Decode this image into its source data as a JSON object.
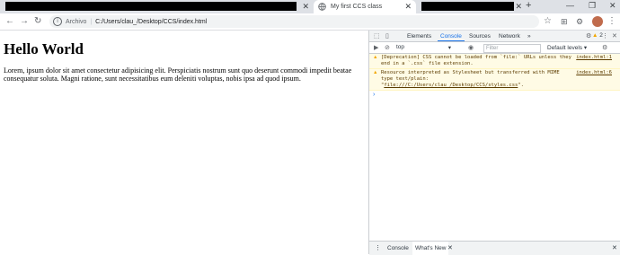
{
  "browser": {
    "tabs": [
      {
        "label": "",
        "redacted": true
      },
      {
        "label": "My first CCS class",
        "active": true
      },
      {
        "label": "",
        "redacted": true
      }
    ],
    "close_glyph": "✕",
    "new_tab_glyph": "+",
    "window_controls": [
      "—",
      "❐",
      "✕"
    ],
    "nav": {
      "back": "←",
      "forward": "→",
      "reload": "↻"
    },
    "address": {
      "info_glyph": "i",
      "scheme_label": "Archivo",
      "separator": "|",
      "url": "C:/Users/clau_/Desktop/CCS/index.html"
    },
    "toolbar_icons": {
      "star": "☆",
      "extension1": "⊞",
      "extension2": "⚙",
      "menu": "⋮"
    }
  },
  "page": {
    "heading": "Hello World",
    "paragraph": "Lorem, ipsum dolor sit amet consectetur adipisicing elit. Perspiciatis nostrum sunt quo deserunt commodi impedit beatae consequatur soluta. Magni ratione, sunt necessitatibus eum deleniti voluptas, nobis ipsa ad quod ipsum."
  },
  "devtools": {
    "tabs": [
      "Elements",
      "Console",
      "Sources",
      "Network",
      "»"
    ],
    "active_tab": "Console",
    "warning_count": "2",
    "toolbar": {
      "context": "top",
      "filter_placeholder": "Filter",
      "levels": "Default levels ▾"
    },
    "messages": [
      {
        "text": "[Deprecation] CSS cannot be loaded from `file:` URLs unless they end in a `.css` file extension.",
        "source": "index.html:1"
      },
      {
        "text_before": "Resource interpreted as Stylesheet but transferred with MIME type text/plain: \"",
        "link": "file:///C:/Users/clau_/Desktop/CCS/styles.css",
        "text_after": "\".",
        "source": "index.html:6"
      }
    ],
    "prompt": "›",
    "drawer": {
      "menu": "⋮",
      "tabs": [
        "Console",
        "What's New"
      ],
      "close_tab": "✕",
      "close_drawer": "✕"
    }
  },
  "colors": {
    "accent": "#1a73e8",
    "warning": "#f2a600",
    "warning_bg": "#fffbe5"
  }
}
